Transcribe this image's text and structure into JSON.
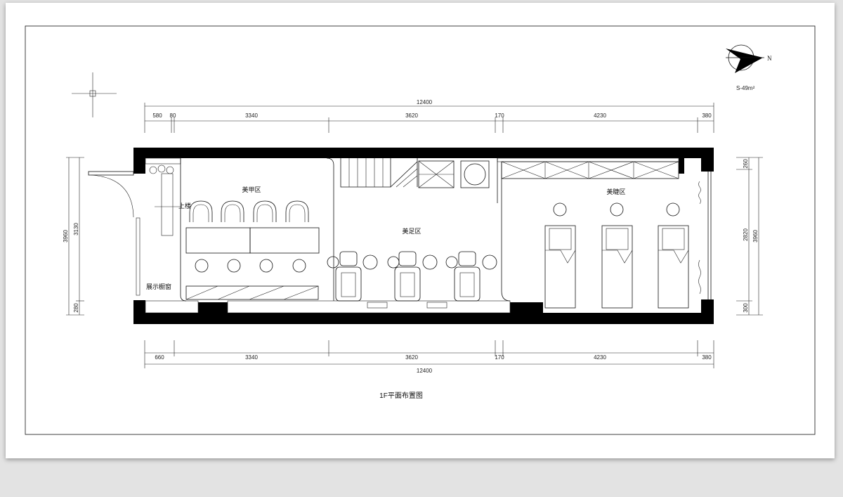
{
  "drawing": {
    "title": "1F平面布置图",
    "area": "S-49m²",
    "north_label": "N"
  },
  "dimensions": {
    "top_total": "12400",
    "top_segments": [
      "580",
      "80",
      "3340",
      "3620",
      "170",
      "4230",
      "380"
    ],
    "bottom_total": "12400",
    "bottom_segments": [
      "660",
      "3340",
      "3620",
      "170",
      "4230",
      "380"
    ],
    "left": [
      "3960",
      "3130",
      "280"
    ],
    "right": [
      "260",
      "2820",
      "3960",
      "300"
    ]
  },
  "rooms": {
    "nail_area": "美甲区",
    "foot_area": "美足区",
    "eyelash_area": "美睫区",
    "stairs_up": "上楼",
    "display_window": "展示橱窗"
  }
}
